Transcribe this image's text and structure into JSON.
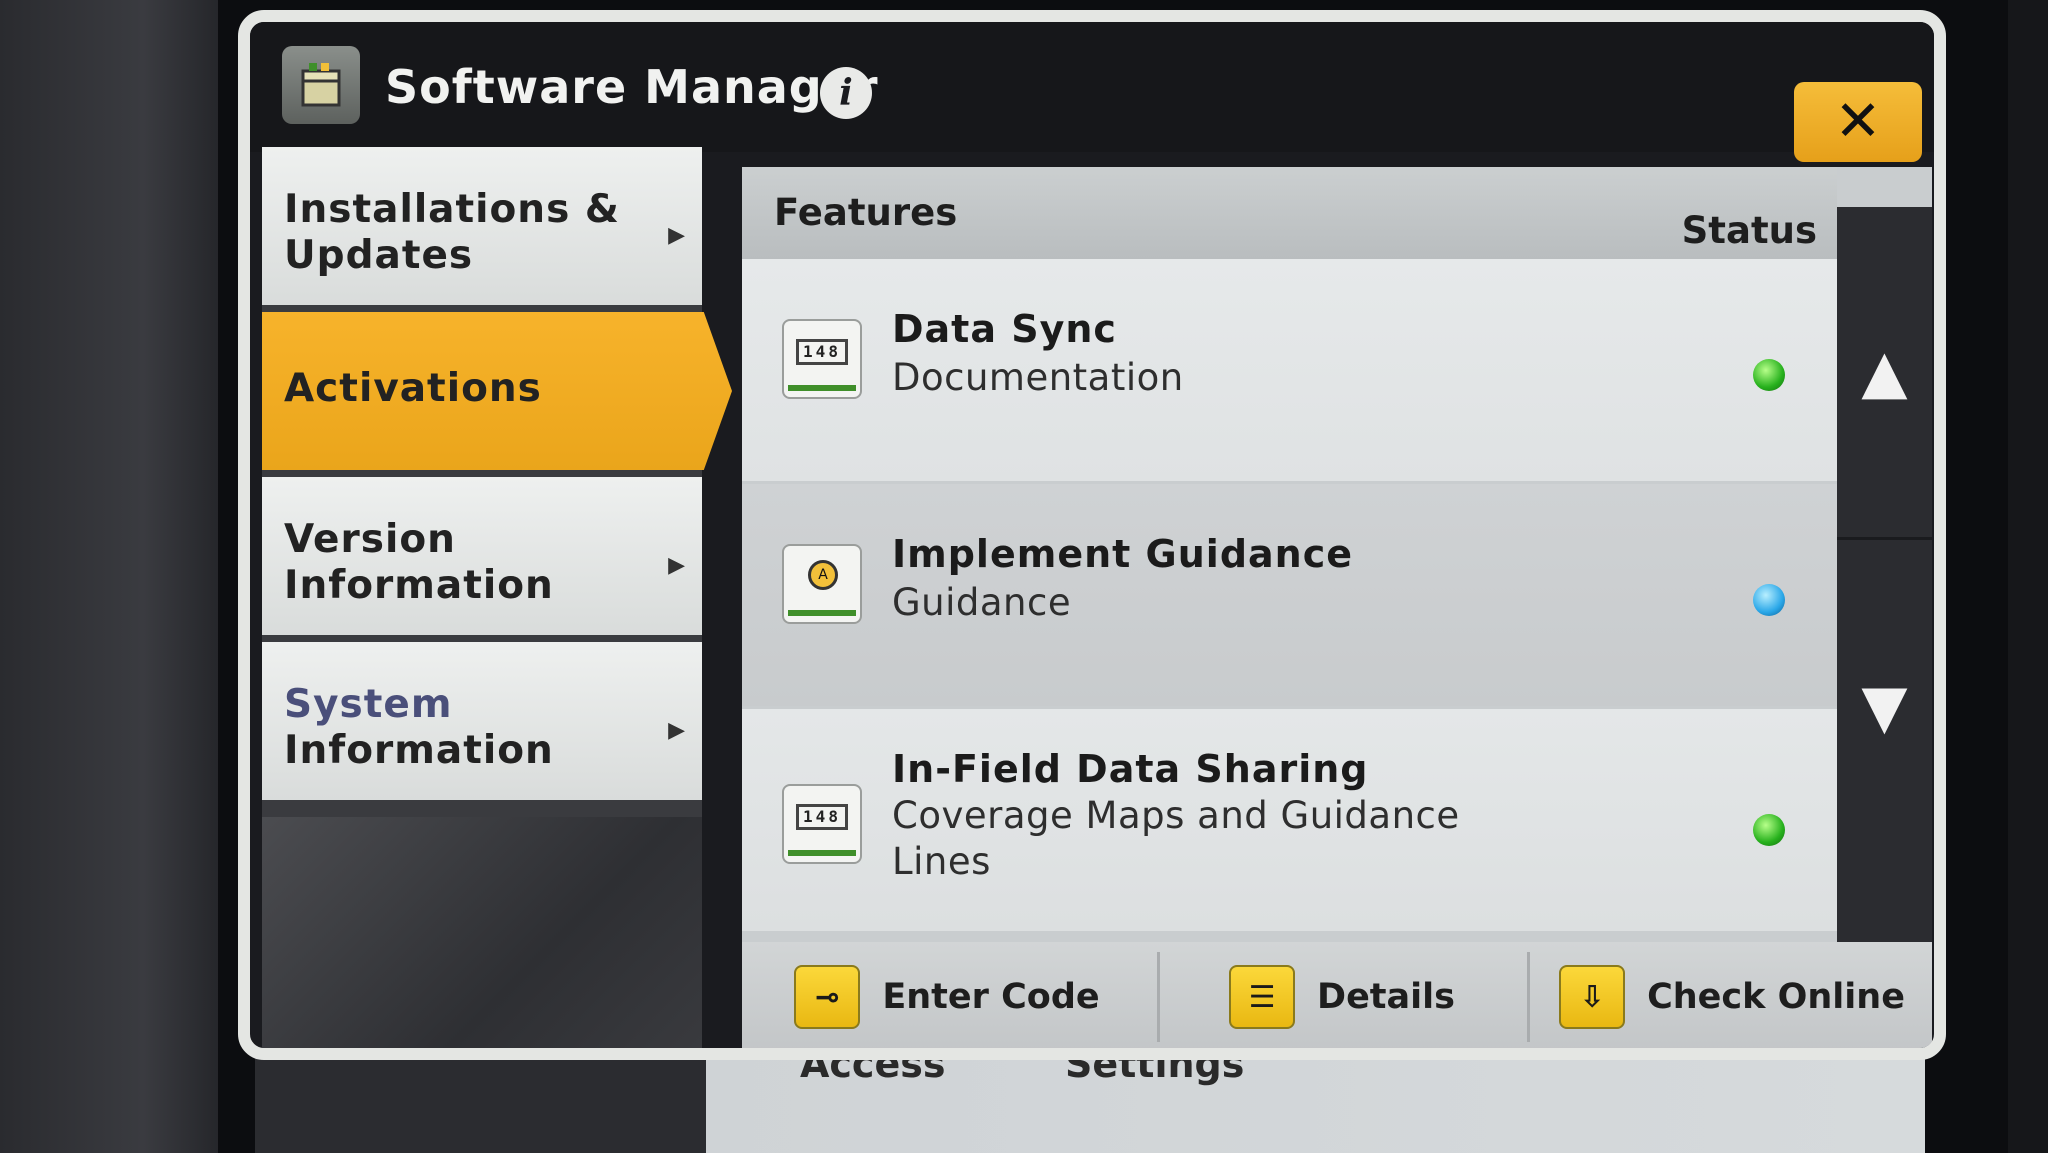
{
  "window": {
    "title": "Software Manager",
    "info_icon": "i",
    "close_icon": "✕"
  },
  "nav": {
    "items": [
      {
        "label_line1": "Installations &",
        "label_line2": "Updates",
        "arrow": "▶"
      },
      {
        "label_line1": "Activations",
        "label_line2": ""
      },
      {
        "label_line1": "Version",
        "label_line2": "Information",
        "arrow": "▶"
      },
      {
        "label_line1": "System",
        "label_line2": "Information",
        "arrow": "▶"
      }
    ]
  },
  "table": {
    "header_features": "Features",
    "header_status": "Status",
    "rows": [
      {
        "name": "Data Sync",
        "category": "Documentation",
        "icon_text": "148",
        "status_color": "#27b11d"
      },
      {
        "name": "Implement Guidance",
        "category": "Guidance",
        "icon_text": "A",
        "status_color": "#2aa7e8"
      },
      {
        "name": "In-Field Data Sharing",
        "category_line1": "Coverage Maps and Guidance",
        "category_line2": "Lines",
        "icon_text": "148",
        "status_color": "#27b11d"
      }
    ]
  },
  "scroll": {
    "up": "▲",
    "down": "▼"
  },
  "footer": {
    "enter_code": "Enter Code",
    "details": "Details",
    "check_online": "Check Online",
    "enter_code_icon": "⊸",
    "details_icon": "☰",
    "check_online_icon": "⇩"
  },
  "background": {
    "label_left": "Access",
    "label_right": "Settings"
  },
  "colors": {
    "accent_yellow": "#f0ab22",
    "status_green": "#27b11d",
    "status_blue": "#2aa7e8"
  }
}
